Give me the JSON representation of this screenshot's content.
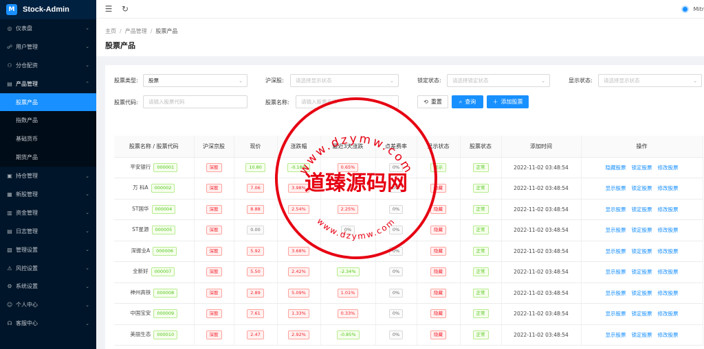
{
  "app": {
    "logo_mark": "M",
    "name": "Stock-Admin"
  },
  "sidebar": {
    "items": [
      {
        "icon": "dashboard-icon",
        "glyph": "◎",
        "label": "仪表盘",
        "expanded": false
      },
      {
        "icon": "users-icon",
        "glyph": "☍",
        "label": "用户管理",
        "expanded": false
      },
      {
        "icon": "branch-icon",
        "glyph": "⚇",
        "label": "分仓配资",
        "expanded": false
      },
      {
        "icon": "product-icon",
        "glyph": "▤",
        "label": "产品管理",
        "expanded": true,
        "children": [
          {
            "label": "股票产品",
            "active": true
          },
          {
            "label": "指数产品",
            "active": false
          },
          {
            "label": "基础货币",
            "active": false
          },
          {
            "label": "期货产品",
            "active": false
          }
        ]
      },
      {
        "icon": "position-icon",
        "glyph": "▣",
        "label": "持仓管理",
        "expanded": false
      },
      {
        "icon": "ipo-icon",
        "glyph": "▦",
        "label": "新股管理",
        "expanded": false
      },
      {
        "icon": "funds-icon",
        "glyph": "▥",
        "label": "资金管理",
        "expanded": false
      },
      {
        "icon": "log-icon",
        "glyph": "▤",
        "label": "日志管理",
        "expanded": false
      },
      {
        "icon": "manage-icon",
        "glyph": "▧",
        "label": "管理设置",
        "expanded": false
      },
      {
        "icon": "risk-icon",
        "glyph": "⚠",
        "label": "风控设置",
        "expanded": false
      },
      {
        "icon": "settings-icon",
        "glyph": "⚙",
        "label": "系统设置",
        "expanded": false
      },
      {
        "icon": "person-icon",
        "glyph": "☺",
        "label": "个人中心",
        "expanded": false
      },
      {
        "icon": "support-icon",
        "glyph": "☊",
        "label": "客服中心",
        "expanded": false
      }
    ]
  },
  "header": {
    "user_name": "Mitr"
  },
  "breadcrumb": [
    "主页",
    "产品管理",
    "股票产品"
  ],
  "page_title": "股票产品",
  "filters": {
    "stock_type": {
      "label": "股票类型:",
      "value": "股票"
    },
    "market": {
      "label": "沪深股:",
      "placeholder": "请选择显示状态"
    },
    "lock_status": {
      "label": "锁定状态:",
      "placeholder": "请选择锁定状态"
    },
    "show_status": {
      "label": "显示状态:",
      "placeholder": "请选择显示状态"
    },
    "stock_code": {
      "label": "股票代码:",
      "placeholder": "请输入股票代码"
    },
    "stock_name": {
      "label": "股票名称:",
      "placeholder": "请输入股票名称"
    },
    "reset_label": "重置",
    "query_label": "查询",
    "add_label": "添加股票"
  },
  "table": {
    "columns": [
      "股票名称 / 股票代码",
      "沪深京股",
      "现价",
      "涨跌幅",
      "最近3天涨跌",
      "点差费率",
      "显示状态",
      "股票状态",
      "添加时间",
      "操作"
    ],
    "rows": [
      {
        "name": "平安银行",
        "code": "000001",
        "market": "深股",
        "price": "10.80",
        "price_color": "green",
        "change": "-0.18%",
        "change_color": "green",
        "change3": "0.65%",
        "change3_color": "red",
        "spread": "0%",
        "show": "显示",
        "show_color": "green",
        "status": "正常",
        "time": "2022-11-02 03:48:54",
        "ops": [
          "隐藏股票",
          "锁定股票",
          "修改股票"
        ]
      },
      {
        "name": "万 科A",
        "code": "000002",
        "market": "深股",
        "price": "7.06",
        "price_color": "red",
        "change": "3.98%",
        "change_color": "red",
        "change3": "",
        "change3_color": "red",
        "spread": "0%",
        "show": "隐藏",
        "show_color": "red",
        "status": "正常",
        "time": "2022-11-02 03:48:54",
        "ops": [
          "显示股票",
          "锁定股票",
          "修改股票"
        ]
      },
      {
        "name": "ST国华",
        "code": "000004",
        "market": "深股",
        "price": "8.88",
        "price_color": "red",
        "change": "2.54%",
        "change_color": "red",
        "change3": "2.25%",
        "change3_color": "red",
        "spread": "0%",
        "show": "隐藏",
        "show_color": "red",
        "status": "正常",
        "time": "2022-11-02 03:48:54",
        "ops": [
          "显示股票",
          "锁定股票",
          "修改股票"
        ]
      },
      {
        "name": "ST星源",
        "code": "000005",
        "market": "深股",
        "price": "0.00",
        "price_color": "gray",
        "change": "",
        "change_color": "gray",
        "change3": "0%",
        "change3_color": "gray",
        "spread": "0%",
        "show": "隐藏",
        "show_color": "red",
        "status": "正常",
        "time": "2022-11-02 03:48:54",
        "ops": [
          "显示股票",
          "锁定股票",
          "修改股票"
        ]
      },
      {
        "name": "深振业A",
        "code": "000006",
        "market": "深股",
        "price": "5.92",
        "price_color": "red",
        "change": "3.68%",
        "change_color": "red",
        "change3": "",
        "change3_color": "red",
        "spread": "0%",
        "show": "隐藏",
        "show_color": "red",
        "status": "正常",
        "time": "2022-11-02 03:48:54",
        "ops": [
          "显示股票",
          "锁定股票",
          "修改股票"
        ]
      },
      {
        "name": "全新好",
        "code": "000007",
        "market": "深股",
        "price": "5.50",
        "price_color": "red",
        "change": "2.42%",
        "change_color": "red",
        "change3": "-2.34%",
        "change3_color": "green",
        "spread": "0%",
        "show": "隐藏",
        "show_color": "red",
        "status": "正常",
        "time": "2022-11-02 03:48:54",
        "ops": [
          "显示股票",
          "锁定股票",
          "修改股票"
        ]
      },
      {
        "name": "神州高铁",
        "code": "000008",
        "market": "深股",
        "price": "2.89",
        "price_color": "red",
        "change": "5.09%",
        "change_color": "red",
        "change3": "1.01%",
        "change3_color": "red",
        "spread": "0%",
        "show": "隐藏",
        "show_color": "red",
        "status": "正常",
        "time": "2022-11-02 03:48:54",
        "ops": [
          "显示股票",
          "锁定股票",
          "修改股票"
        ]
      },
      {
        "name": "中国宝安",
        "code": "000009",
        "market": "深股",
        "price": "7.61",
        "price_color": "red",
        "change": "1.33%",
        "change_color": "red",
        "change3": "0.33%",
        "change3_color": "red",
        "spread": "0%",
        "show": "隐藏",
        "show_color": "red",
        "status": "正常",
        "time": "2022-11-02 03:48:54",
        "ops": [
          "显示股票",
          "锁定股票",
          "修改股票"
        ]
      },
      {
        "name": "美丽生态",
        "code": "000010",
        "market": "深股",
        "price": "2.47",
        "price_color": "red",
        "change": "2.92%",
        "change_color": "red",
        "change3": "-0.85%",
        "change3_color": "green",
        "spread": "0%",
        "show": "隐藏",
        "show_color": "red",
        "status": "正常",
        "time": "2022-11-02 03:48:54",
        "ops": [
          "显示股票",
          "锁定股票",
          "修改股票"
        ]
      }
    ]
  },
  "watermark": {
    "text_main": "道臻源码网",
    "text_top": "www.dzymw.com",
    "text_bottom": "www.dzymw.com",
    "color": "#e60012"
  }
}
